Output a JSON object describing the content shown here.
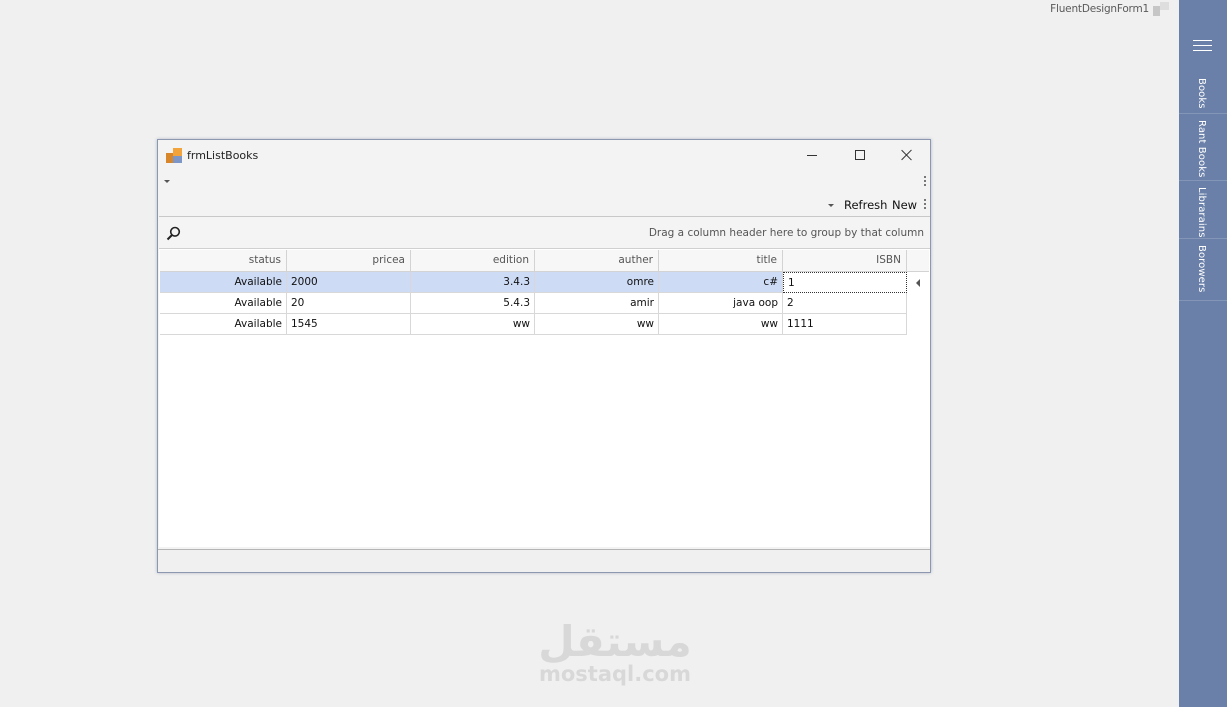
{
  "host": {
    "title": "FluentDesignForm1"
  },
  "sidebar": {
    "items": [
      {
        "label": "Books"
      },
      {
        "label": "Rant Books"
      },
      {
        "label": "Librarains"
      },
      {
        "label": "Borowers"
      }
    ]
  },
  "window": {
    "title": "frmListBooks",
    "minimize_label": "",
    "maximize_label": "",
    "close_label": ""
  },
  "toolbar": {
    "refresh_label": "Refresh",
    "new_label": "New"
  },
  "grid": {
    "group_hint": "Drag a column header here to group by that column",
    "columns": [
      "status",
      "pricea",
      "edition",
      "auther",
      "title",
      "ISBN"
    ],
    "rows": [
      [
        "Available",
        "2000",
        "3.4.3",
        "omre",
        "c#",
        "1"
      ],
      [
        "Available",
        "20",
        "5.4.3",
        "amir",
        "java oop",
        "2"
      ],
      [
        "Available",
        "1545",
        "ww",
        "ww",
        "ww",
        "1111"
      ]
    ],
    "selected_row": 0
  },
  "watermark": {
    "arabic": "مستقل",
    "latin": "mostaql.com"
  },
  "colors": {
    "sidebar": "#6a80a8",
    "selection": "#cddbf5"
  }
}
